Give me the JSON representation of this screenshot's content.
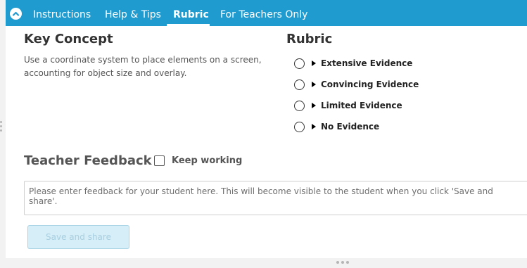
{
  "nav": {
    "tabs": [
      {
        "label": "Instructions",
        "active": false
      },
      {
        "label": "Help & Tips",
        "active": false
      },
      {
        "label": "Rubric",
        "active": true
      },
      {
        "label": "For Teachers Only",
        "active": false
      }
    ],
    "bar_color": "#1f9bd0",
    "collapse_icon": "chevron-up-icon"
  },
  "key_concept": {
    "heading": "Key Concept",
    "text": "Use a coordinate system to place elements on a screen, accounting for object size and overlay."
  },
  "rubric": {
    "heading": "Rubric",
    "items": [
      {
        "label": "Extensive Evidence"
      },
      {
        "label": "Convincing Evidence"
      },
      {
        "label": "Limited Evidence"
      },
      {
        "label": "No Evidence"
      }
    ]
  },
  "feedback": {
    "heading": "Teacher Feedback",
    "keep_working_label": "Keep working",
    "keep_working_checked": false,
    "placeholder": "Please enter feedback for your student here. This will become visible to the student when you click 'Save and share'.",
    "value": "",
    "save_label": "Save and share"
  }
}
